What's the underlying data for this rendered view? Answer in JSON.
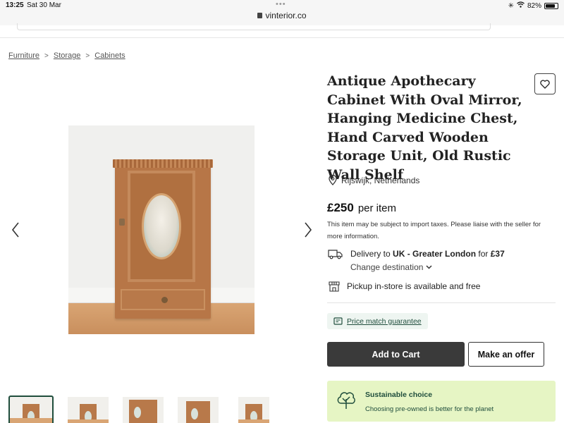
{
  "status_bar": {
    "time": "13:25",
    "date": "Sat 30 Mar",
    "url": "vinterior.co",
    "battery": "82%"
  },
  "breadcrumb": [
    "Furniture",
    "Storage",
    "Cabinets"
  ],
  "product": {
    "title": "Antique Apothecary Cabinet With Oval Mirror, Hanging Medicine Chest, Hand Carved Wooden Storage Unit, Old Rustic Wall Shelf",
    "location": "Rijswijk, Netherlands",
    "price": "£250",
    "price_unit": "per item",
    "tax_note": "This item may be subject to import taxes. Please liaise with the seller for more information."
  },
  "delivery": {
    "prefix": "Delivery to ",
    "destination": "UK - Greater London",
    "for": " for ",
    "cost": "£37",
    "change": "Change destination"
  },
  "pickup": "Pickup in-store is available and free",
  "price_match": "Price match guarantee",
  "actions": {
    "add_to_cart": "Add to Cart",
    "make_offer": "Make an offer"
  },
  "sustainable": {
    "heading": "Sustainable choice",
    "subtext": "Choosing pre-owned is better for the planet"
  },
  "gallery": {
    "thumbnail_count": 5,
    "active_thumbnail": 1
  },
  "colors": {
    "brand_green": "#1f4d3c",
    "sustain_bg": "#e6f5c4",
    "cart_button": "#3a3a3a"
  }
}
